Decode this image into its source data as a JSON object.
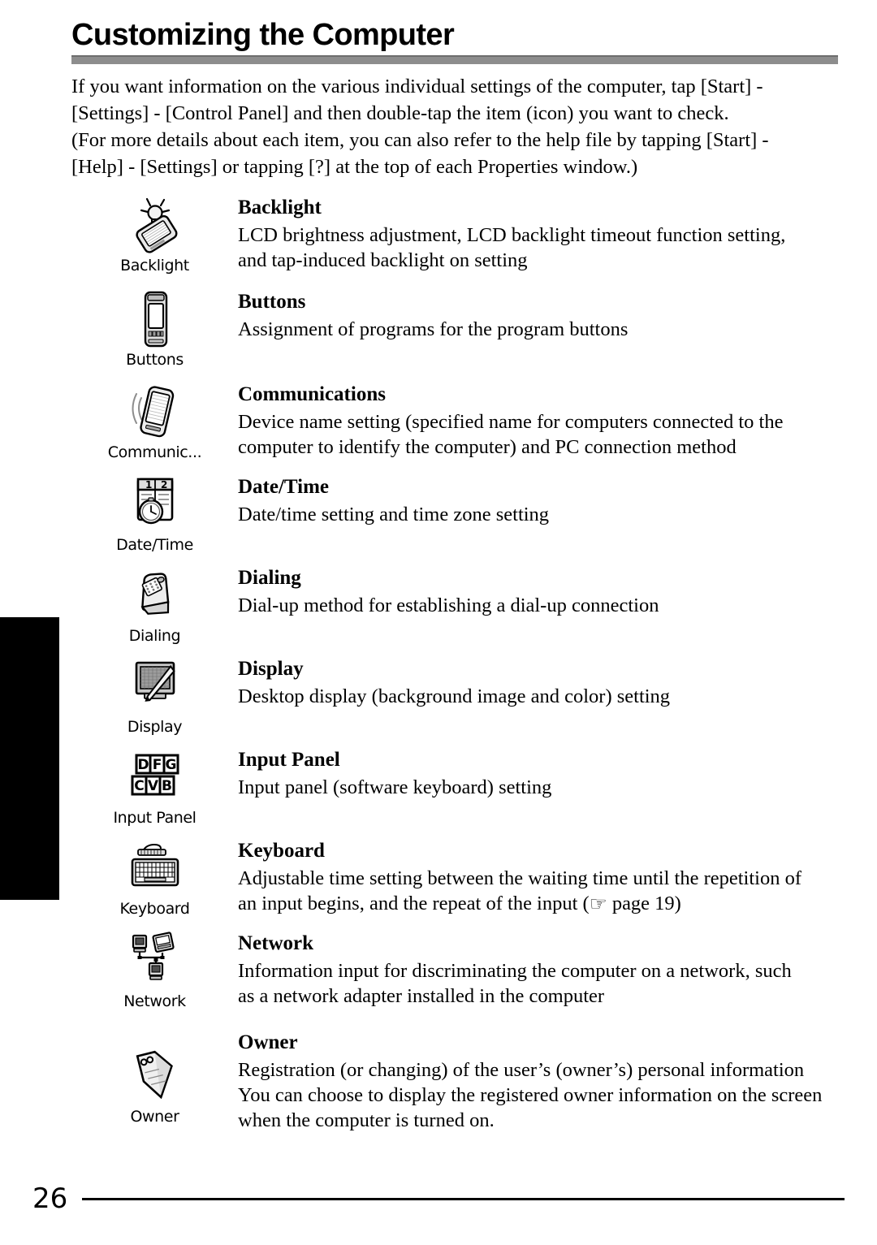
{
  "page": {
    "title": "Customizing the Computer",
    "number": "26"
  },
  "intro": {
    "line1": "If you want information on the various individual settings of the computer, tap [Start] -",
    "line2": "[Settings] - [Control Panel] and then double-tap the item (icon) you want to check.",
    "line3": "(For more details about each item, you can also refer to the help file by tapping [Start] -",
    "line4": "[Help] - [Settings] or tapping [?] at the top of each Properties window.)"
  },
  "items": [
    {
      "icon_name": "backlight-icon",
      "icon_caption": "Backlight",
      "title": "Backlight",
      "desc_line1": "LCD brightness adjustment, LCD backlight timeout function setting,",
      "desc_line2": "and tap-induced backlight on setting"
    },
    {
      "icon_name": "buttons-icon",
      "icon_caption": "Buttons",
      "title": "Buttons",
      "desc_line1": "Assignment of programs for the program buttons",
      "desc_line2": ""
    },
    {
      "icon_name": "communications-icon",
      "icon_caption": "Communic...",
      "title": "Communications",
      "desc_line1": "Device name setting (specified name for computers connected to the",
      "desc_line2": "computer to identify the computer) and PC connection method"
    },
    {
      "icon_name": "date-time-icon",
      "icon_caption": "Date/Time",
      "title": "Date/Time",
      "desc_line1": "Date/time setting and time zone setting",
      "desc_line2": ""
    },
    {
      "icon_name": "dialing-icon",
      "icon_caption": "Dialing",
      "title": "Dialing",
      "desc_line1": "Dial-up method for establishing a dial-up connection",
      "desc_line2": ""
    },
    {
      "icon_name": "display-icon",
      "icon_caption": "Display",
      "title": "Display",
      "desc_line1": "Desktop display (background image and color) setting",
      "desc_line2": ""
    },
    {
      "icon_name": "input-panel-icon",
      "icon_caption": "Input Panel",
      "title": "Input Panel",
      "desc_line1": "Input panel (software keyboard) setting",
      "desc_line2": "",
      "icon_keys_top": [
        "D",
        "F",
        "G"
      ],
      "icon_keys_bottom": [
        "C",
        "V",
        "B"
      ]
    },
    {
      "icon_name": "keyboard-icon",
      "icon_caption": "Keyboard",
      "title": "Keyboard",
      "desc_line1": "Adjustable time setting between the waiting time until the repetition of",
      "desc_line2_pre": "an input begins, and the repeat of the input (",
      "desc_line2_hand": "☞",
      "desc_line2_post": " page 19)"
    },
    {
      "icon_name": "network-icon",
      "icon_caption": "Network",
      "title": "Network",
      "desc_line1": "Information input for discriminating the computer on a network, such",
      "desc_line2": "as a network adapter installed in the computer"
    },
    {
      "icon_name": "owner-icon",
      "icon_caption": "Owner",
      "title": "Owner",
      "desc_line1": "Registration (or changing) of the user’s (owner’s) personal information",
      "desc_line2": "You can choose to display the registered owner information on the screen",
      "desc_line3": "when the computer is turned on."
    }
  ],
  "colors": {
    "header_rule": "#8d8d8d",
    "header_rule_top": "#6d6d6d",
    "thumb_tab": "#000000",
    "text": "#000000"
  }
}
